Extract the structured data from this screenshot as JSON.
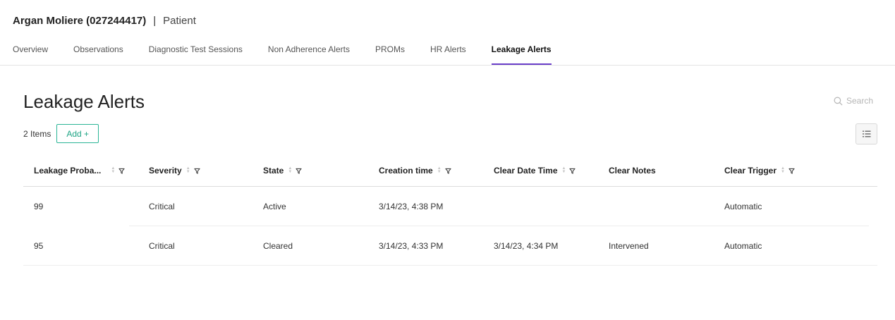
{
  "header": {
    "patient_name": "Argan Moliere (027244417)",
    "separator": "|",
    "role": "Patient"
  },
  "tabs": [
    {
      "label": "Overview",
      "active": false
    },
    {
      "label": "Observations",
      "active": false
    },
    {
      "label": "Diagnostic Test Sessions",
      "active": false
    },
    {
      "label": "Non Adherence Alerts",
      "active": false
    },
    {
      "label": "PROMs",
      "active": false
    },
    {
      "label": "HR Alerts",
      "active": false
    },
    {
      "label": "Leakage Alerts",
      "active": true
    }
  ],
  "page": {
    "title": "Leakage Alerts",
    "items_count": "2 Items",
    "add_label": "Add +",
    "search_placeholder": "Search"
  },
  "table": {
    "columns": [
      {
        "label": "Leakage Proba...",
        "sortable": true,
        "filterable": true
      },
      {
        "label": "Severity",
        "sortable": true,
        "filterable": true
      },
      {
        "label": "State",
        "sortable": true,
        "filterable": true
      },
      {
        "label": "Creation time",
        "sortable": true,
        "filterable": true
      },
      {
        "label": "Clear Date Time",
        "sortable": true,
        "filterable": true
      },
      {
        "label": "Clear Notes",
        "sortable": false,
        "filterable": false
      },
      {
        "label": "Clear Trigger",
        "sortable": true,
        "filterable": true
      }
    ],
    "rows": [
      [
        "99",
        "Critical",
        "Active",
        "3/14/23, 4:38 PM",
        "",
        "",
        "Automatic"
      ],
      [
        "95",
        "Critical",
        "Cleared",
        "3/14/23, 4:33 PM",
        "3/14/23, 4:34 PM",
        "Intervened",
        "Automatic"
      ]
    ]
  },
  "colors": {
    "accent_tab": "#6a3fc9",
    "add_button": "#2bb596"
  },
  "icons": {
    "search": "search-icon",
    "sort": "sort-icon",
    "filter": "filter-icon",
    "columns": "column-settings-icon"
  }
}
